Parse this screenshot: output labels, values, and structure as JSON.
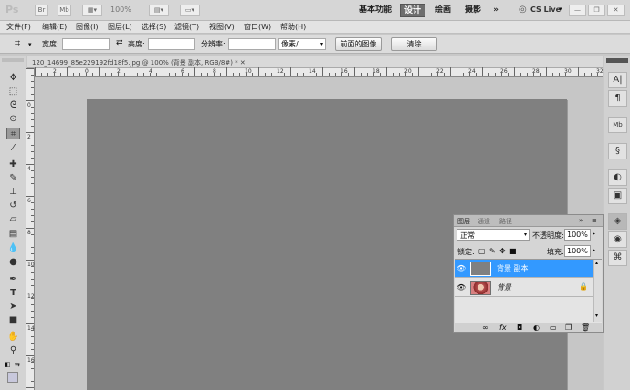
{
  "app_bar": {
    "logo": "Ps",
    "br_label": "Br",
    "mb_label": "Mb",
    "zoom": "100%",
    "workspaces": [
      "基本功能",
      "设计",
      "绘画",
      "摄影"
    ],
    "more": "»",
    "cslive": "CS Live",
    "window_controls": [
      "—",
      "❐",
      "✕"
    ]
  },
  "menu": [
    "文件(F)",
    "编辑(E)",
    "图像(I)",
    "图层(L)",
    "选择(S)",
    "滤镜(T)",
    "视图(V)",
    "窗口(W)",
    "帮助(H)"
  ],
  "options": {
    "width_label": "宽度:",
    "height_label": "高度:",
    "resolution_label": "分辨率:",
    "unit": "像素/...",
    "front_image": "前面的图像",
    "clear": "清除"
  },
  "doc_tab": "120_14699_85e229192fd18f5.jpg @ 100% (背景 副本, RGB/8#) * ✕",
  "ruler_top": [
    "2",
    "0",
    "2",
    "4",
    "6",
    "8",
    "10",
    "12",
    "14",
    "16",
    "18",
    "20",
    "22",
    "24",
    "26",
    "28",
    "30",
    "32",
    "34"
  ],
  "ruler_left": [
    "0",
    "2",
    "4",
    "6",
    "8",
    "10",
    "12",
    "14",
    "16"
  ],
  "layers_panel": {
    "tabs": [
      "图层",
      "通道",
      "路径"
    ],
    "blend_mode": "正常",
    "opacity_label": "不透明度:",
    "opacity": "100%",
    "lock_label": "锁定:",
    "fill_label": "填充:",
    "fill": "100%",
    "layers": [
      {
        "name": "背景 副本",
        "selected": true
      },
      {
        "name": "背景",
        "selected": false
      }
    ],
    "bottom_icons": [
      "link-icon",
      "fx-icon",
      "mask-icon",
      "adjustment-icon",
      "group-icon",
      "new-layer-icon",
      "trash-icon"
    ]
  },
  "colors": {
    "canvas": "#808080",
    "selected_layer": "#3399ff"
  }
}
